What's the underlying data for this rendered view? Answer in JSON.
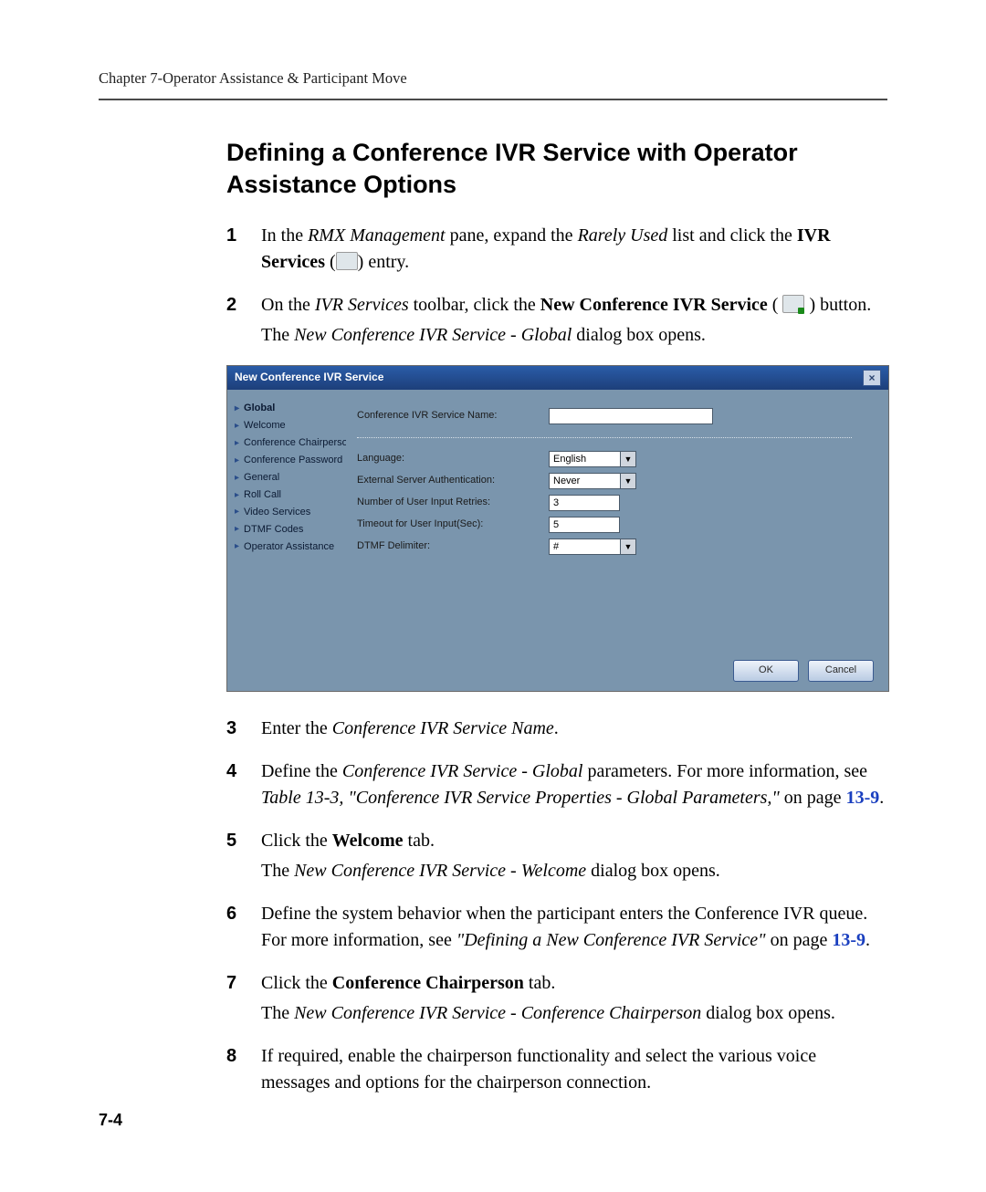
{
  "runningHead": "Chapter 7-Operator Assistance & Participant Move",
  "heading": "Defining a Conference IVR Service with Operator Assistance Options",
  "icons": {
    "ivr_services": "ivr-services-icon",
    "new_conf_ivr": "new-conf-ivr-icon"
  },
  "steps": {
    "s1": {
      "num": "1",
      "a": "In the ",
      "b_i": "RMX Management",
      "c": " pane, expand the ",
      "d_i": "Rarely Used",
      "e": " list and click the ",
      "f_b": "IVR Services",
      "g": " (",
      "h": ") entry."
    },
    "s2": {
      "num": "2",
      "a": "On the ",
      "b_i": "IVR Services",
      "c": " toolbar, click the ",
      "d_b": "New Conference IVR Service",
      "e": " ( ",
      "f": " ) button.",
      "g": "The ",
      "h_i": "New Conference IVR Service - Global",
      "i": " dialog box opens."
    },
    "s3": {
      "num": "3",
      "a": "Enter the ",
      "b_i": "Conference IVR Service Name",
      "c": "."
    },
    "s4": {
      "num": "4",
      "a": "Define the ",
      "b_i": "Conference IVR Service - Global",
      "c": " parameters. For more information, see ",
      "d_i": "Table 13-3, \"Conference IVR Service Properties - Global Parameters,\"",
      "e": " on page ",
      "f_link": "13-9",
      "g": "."
    },
    "s5": {
      "num": "5",
      "a": "Click the ",
      "b_b": "Welcome",
      "c": " tab.",
      "d": "The ",
      "e_i": "New Conference IVR Service - Welcome",
      "f": " dialog box opens."
    },
    "s6": {
      "num": "6",
      "a": "Define the system behavior when the participant enters the Conference IVR queue. For  more information, see ",
      "b_i": "\"Defining a New Conference IVR Service\"",
      "c": " on page ",
      "d_link": "13-9",
      "e": "."
    },
    "s7": {
      "num": "7",
      "a": "Click the ",
      "b_b": "Conference Chairperson",
      "c": " tab.",
      "d": "The ",
      "e_i": "New Conference IVR Service - Conference Chairperson",
      "f": " dialog box opens."
    },
    "s8": {
      "num": "8",
      "a": "If required, enable the chairperson functionality and select the various voice messages and options for the chairperson connection."
    }
  },
  "dialog": {
    "title": "New Conference IVR Service",
    "nav": [
      "Global",
      "Welcome",
      "Conference Chairperson",
      "Conference Password",
      "General",
      "Roll Call",
      "Video Services",
      "DTMF Codes",
      "Operator Assistance"
    ],
    "fields": {
      "name_label": "Conference IVR Service Name:",
      "name_value": "",
      "lang_label": "Language:",
      "lang_value": "English",
      "auth_label": "External Server Authentication:",
      "auth_value": "Never",
      "retries_label": "Number of User Input Retries:",
      "retries_value": "3",
      "timeout_label": "Timeout for User Input(Sec):",
      "timeout_value": "5",
      "dtmf_label": "DTMF Delimiter:",
      "dtmf_value": "#"
    },
    "buttons": {
      "ok": "OK",
      "cancel": "Cancel"
    }
  },
  "pageNumber": "7-4"
}
